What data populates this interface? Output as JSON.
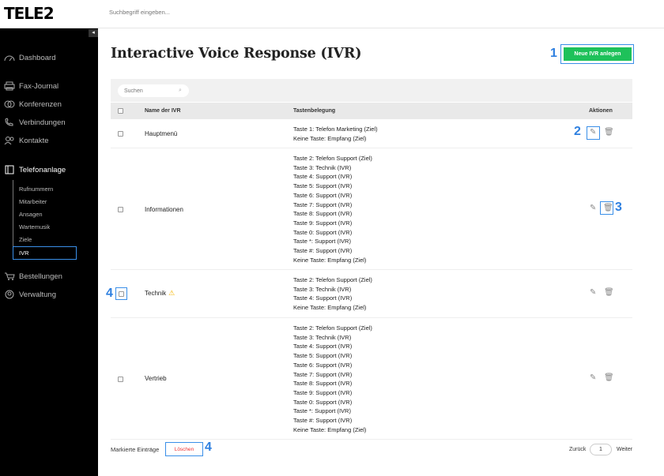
{
  "brand": {
    "logo": "TELE2"
  },
  "topbar": {
    "search_placeholder": "Suchbegriff eingeben..."
  },
  "sidebar": {
    "collapse": "◂",
    "items": [
      {
        "label": "Dashboard",
        "icon": "dashboard-icon"
      },
      {
        "label": "Fax-Journal",
        "icon": "printer-icon"
      },
      {
        "label": "Konferenzen",
        "icon": "conference-icon"
      },
      {
        "label": "Verbindungen",
        "icon": "phone-icon"
      },
      {
        "label": "Kontakte",
        "icon": "contacts-icon"
      },
      {
        "label": "Telefonanlage",
        "icon": "pbx-icon"
      },
      {
        "label": "Bestellungen",
        "icon": "cart-icon"
      },
      {
        "label": "Verwaltung",
        "icon": "admin-icon"
      }
    ],
    "sub_items": [
      "Rufnummern",
      "Mitarbeiter",
      "Ansagen",
      "Wartemusik",
      "Ziele",
      "IVR"
    ]
  },
  "page": {
    "title": "Interactive Voice Response (IVR)",
    "new_button": "Neue IVR anlegen",
    "search_placeholder": "Suchen"
  },
  "table": {
    "headers": {
      "name": "Name der IVR",
      "keys": "Tastenbelegung",
      "actions": "Aktionen"
    },
    "rows": [
      {
        "name": "Hauptmenü",
        "keys": [
          "Taste 1: Telefon Marketing (Ziel)",
          "Keine Taste: Empfang (Ziel)"
        ]
      },
      {
        "name": "Informationen",
        "keys": [
          "Taste 2: Telefon Support (Ziel)",
          "Taste 3: Technik (IVR)",
          "Taste 4: Support (IVR)",
          "Taste 5: Support (IVR)",
          "Taste 6: Support (IVR)",
          "Taste 7: Support (IVR)",
          "Taste 8: Support (IVR)",
          "Taste 9: Support (IVR)",
          "Taste 0: Support (IVR)",
          "Taste *: Support (IVR)",
          "Taste #: Support (IVR)",
          "Keine Taste: Empfang (Ziel)"
        ]
      },
      {
        "name": "Technik",
        "warning": true,
        "keys": [
          "Taste 2: Telefon Support (Ziel)",
          "Taste 3: Technik (IVR)",
          "Taste 4: Support (IVR)",
          "Keine Taste: Empfang (Ziel)"
        ]
      },
      {
        "name": "Vertrieb",
        "keys": [
          "Taste 2: Telefon Support (Ziel)",
          "Taste 3: Technik (IVR)",
          "Taste 4: Support (IVR)",
          "Taste 5: Support (IVR)",
          "Taste 6: Support (IVR)",
          "Taste 7: Support (IVR)",
          "Taste 8: Support (IVR)",
          "Taste 9: Support (IVR)",
          "Taste 0: Support (IVR)",
          "Taste *: Support (IVR)",
          "Taste #: Support (IVR)",
          "Keine Taste: Empfang (Ziel)"
        ]
      }
    ]
  },
  "footer": {
    "marked_label": "Markierte Einträge",
    "delete_button": "Löschen"
  },
  "pagination": {
    "back": "Zurück",
    "page": "1",
    "next": "Weiter"
  },
  "annotations": {
    "n1": "1",
    "n2": "2",
    "n3": "3",
    "n4a": "4",
    "n4b": "4"
  },
  "colors": {
    "accent_green": "#1ec15a",
    "annotation_blue": "#3a8fe8",
    "delete_red": "#ee3333",
    "warning": "#f4b400"
  }
}
